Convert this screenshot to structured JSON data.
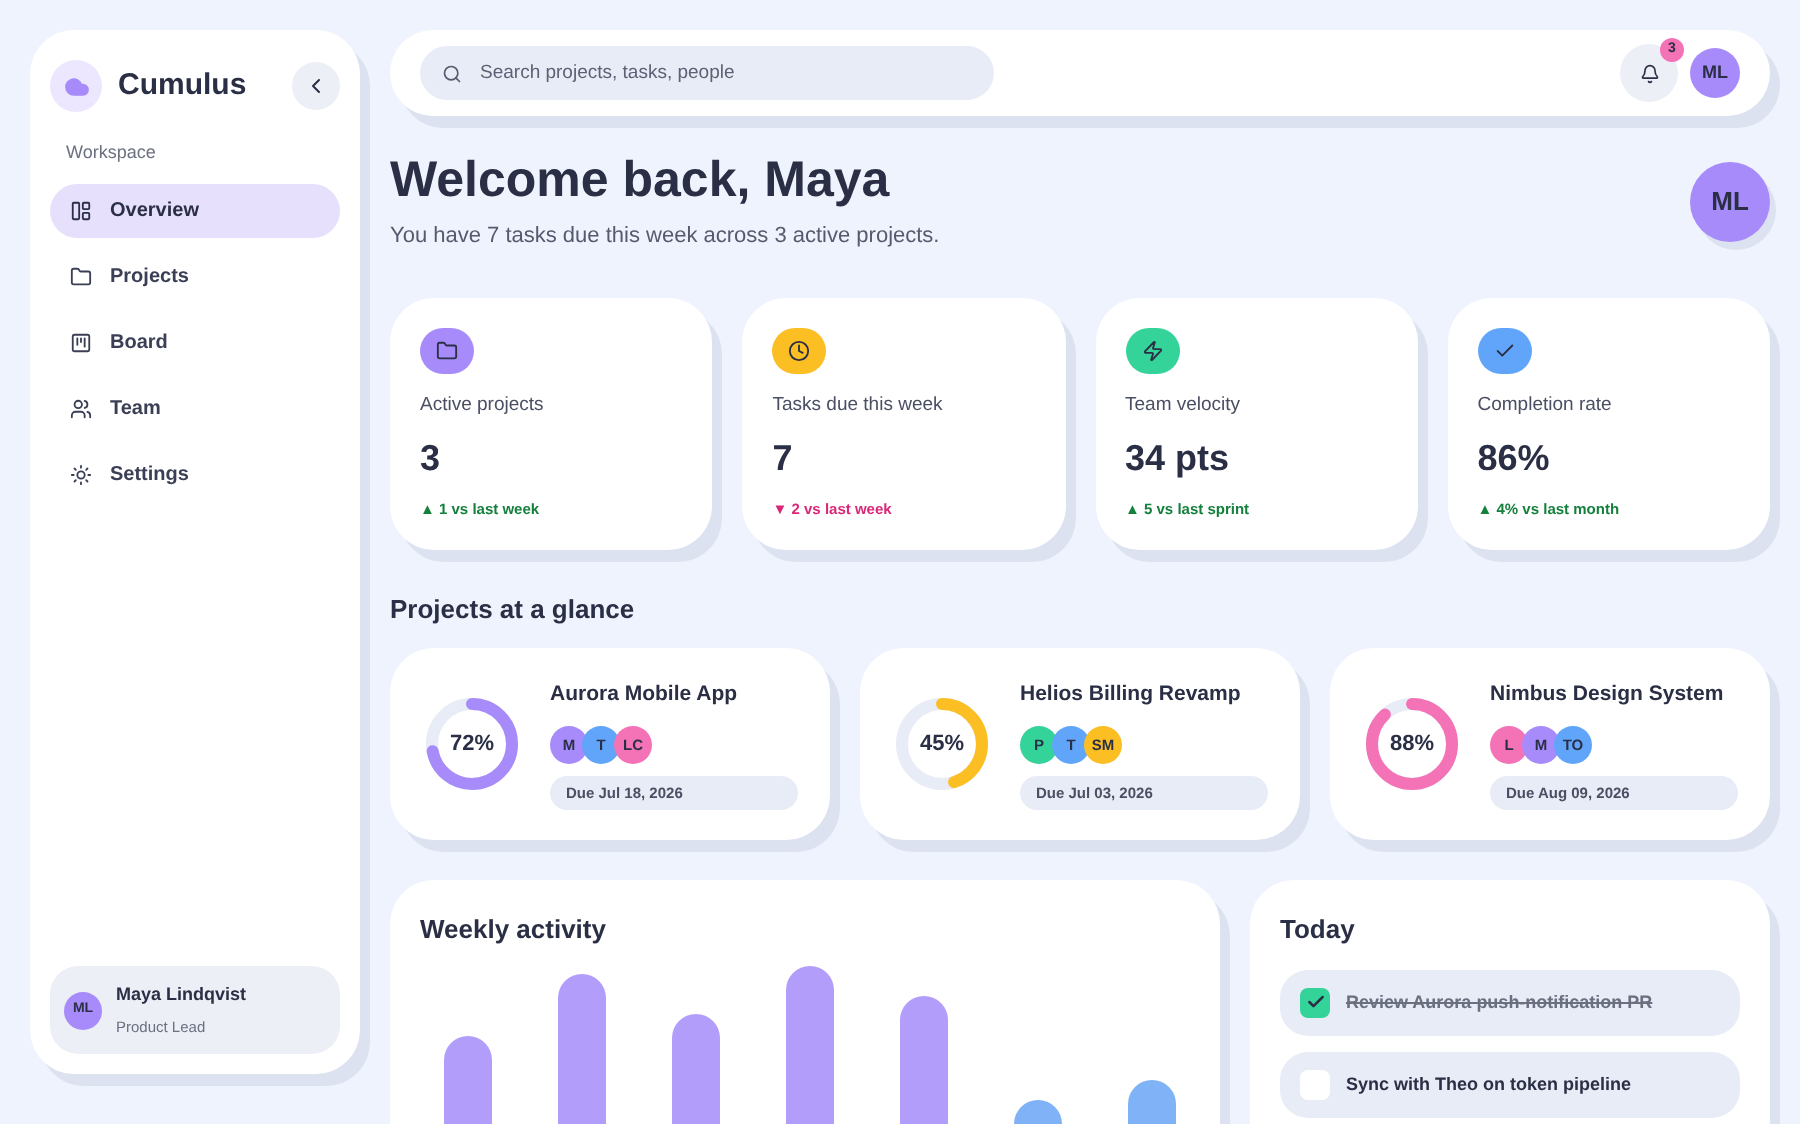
{
  "sidebar": {
    "brand": "Cumulus",
    "section_label": "Workspace",
    "items": [
      {
        "label": "Overview",
        "selected": true
      },
      {
        "label": "Projects",
        "selected": false
      },
      {
        "label": "Board",
        "selected": false
      },
      {
        "label": "Team",
        "selected": false
      },
      {
        "label": "Settings",
        "selected": false
      }
    ],
    "user": {
      "initials": "ML",
      "name": "Maya Lindqvist",
      "role": "Product Lead"
    }
  },
  "topbar": {
    "search": {
      "placeholder": "Search projects, tasks, people"
    },
    "notifications": "3",
    "avatar": "ML"
  },
  "header": {
    "title": "Welcome back, Maya",
    "subtitle": "You have 7 tasks due this week across 3 active projects.",
    "avatar": "ML"
  },
  "stats": [
    {
      "label": "Active projects",
      "value": "3",
      "change": "▲ 1 vs last week",
      "kind": "up",
      "color": "#a78bfa"
    },
    {
      "label": "Tasks due this week",
      "value": "7",
      "change": "▼ 2 vs last week",
      "kind": "down",
      "color": "#fbbf24"
    },
    {
      "label": "Team velocity",
      "value": "34 pts",
      "change": "▲ 5 vs last sprint",
      "kind": "up",
      "color": "#34d399"
    },
    {
      "label": "Completion rate",
      "value": "86%",
      "change": "▲ 4% vs last month",
      "kind": "up",
      "color": "#60a5fa"
    }
  ],
  "projects_title": "Projects at a glance",
  "projects": [
    {
      "name": "Aurora Mobile App",
      "level": 0.72,
      "percent": "72%",
      "color": "#a78bfa",
      "due": "Due Jul 18, 2026",
      "members": [
        {
          "initials": "M",
          "color": "#a78bfa"
        },
        {
          "initials": "T",
          "color": "#60a5fa"
        },
        {
          "initials": "LC",
          "color": "#f472b6"
        }
      ]
    },
    {
      "name": "Helios Billing Revamp",
      "level": 0.45,
      "percent": "45%",
      "color": "#fbbf24",
      "due": "Due Jul 03, 2026",
      "members": [
        {
          "initials": "P",
          "color": "#34d399"
        },
        {
          "initials": "T",
          "color": "#60a5fa"
        },
        {
          "initials": "SM",
          "color": "#fbbf24"
        }
      ]
    },
    {
      "name": "Nimbus Design System",
      "level": 0.88,
      "percent": "88%",
      "color": "#f472b6",
      "due": "Due Aug 09, 2026",
      "members": [
        {
          "initials": "L",
          "color": "#f472b6"
        },
        {
          "initials": "M",
          "color": "#a78bfa"
        },
        {
          "initials": "TO",
          "color": "#60a5fa"
        }
      ]
    }
  ],
  "activity": {
    "title": "Weekly activity"
  },
  "today": {
    "title": "Today",
    "tasks": [
      {
        "label": "Review Aurora push-notification PR",
        "checked": true
      },
      {
        "label": "Sync with Theo on token pipeline",
        "checked": false
      }
    ]
  }
}
